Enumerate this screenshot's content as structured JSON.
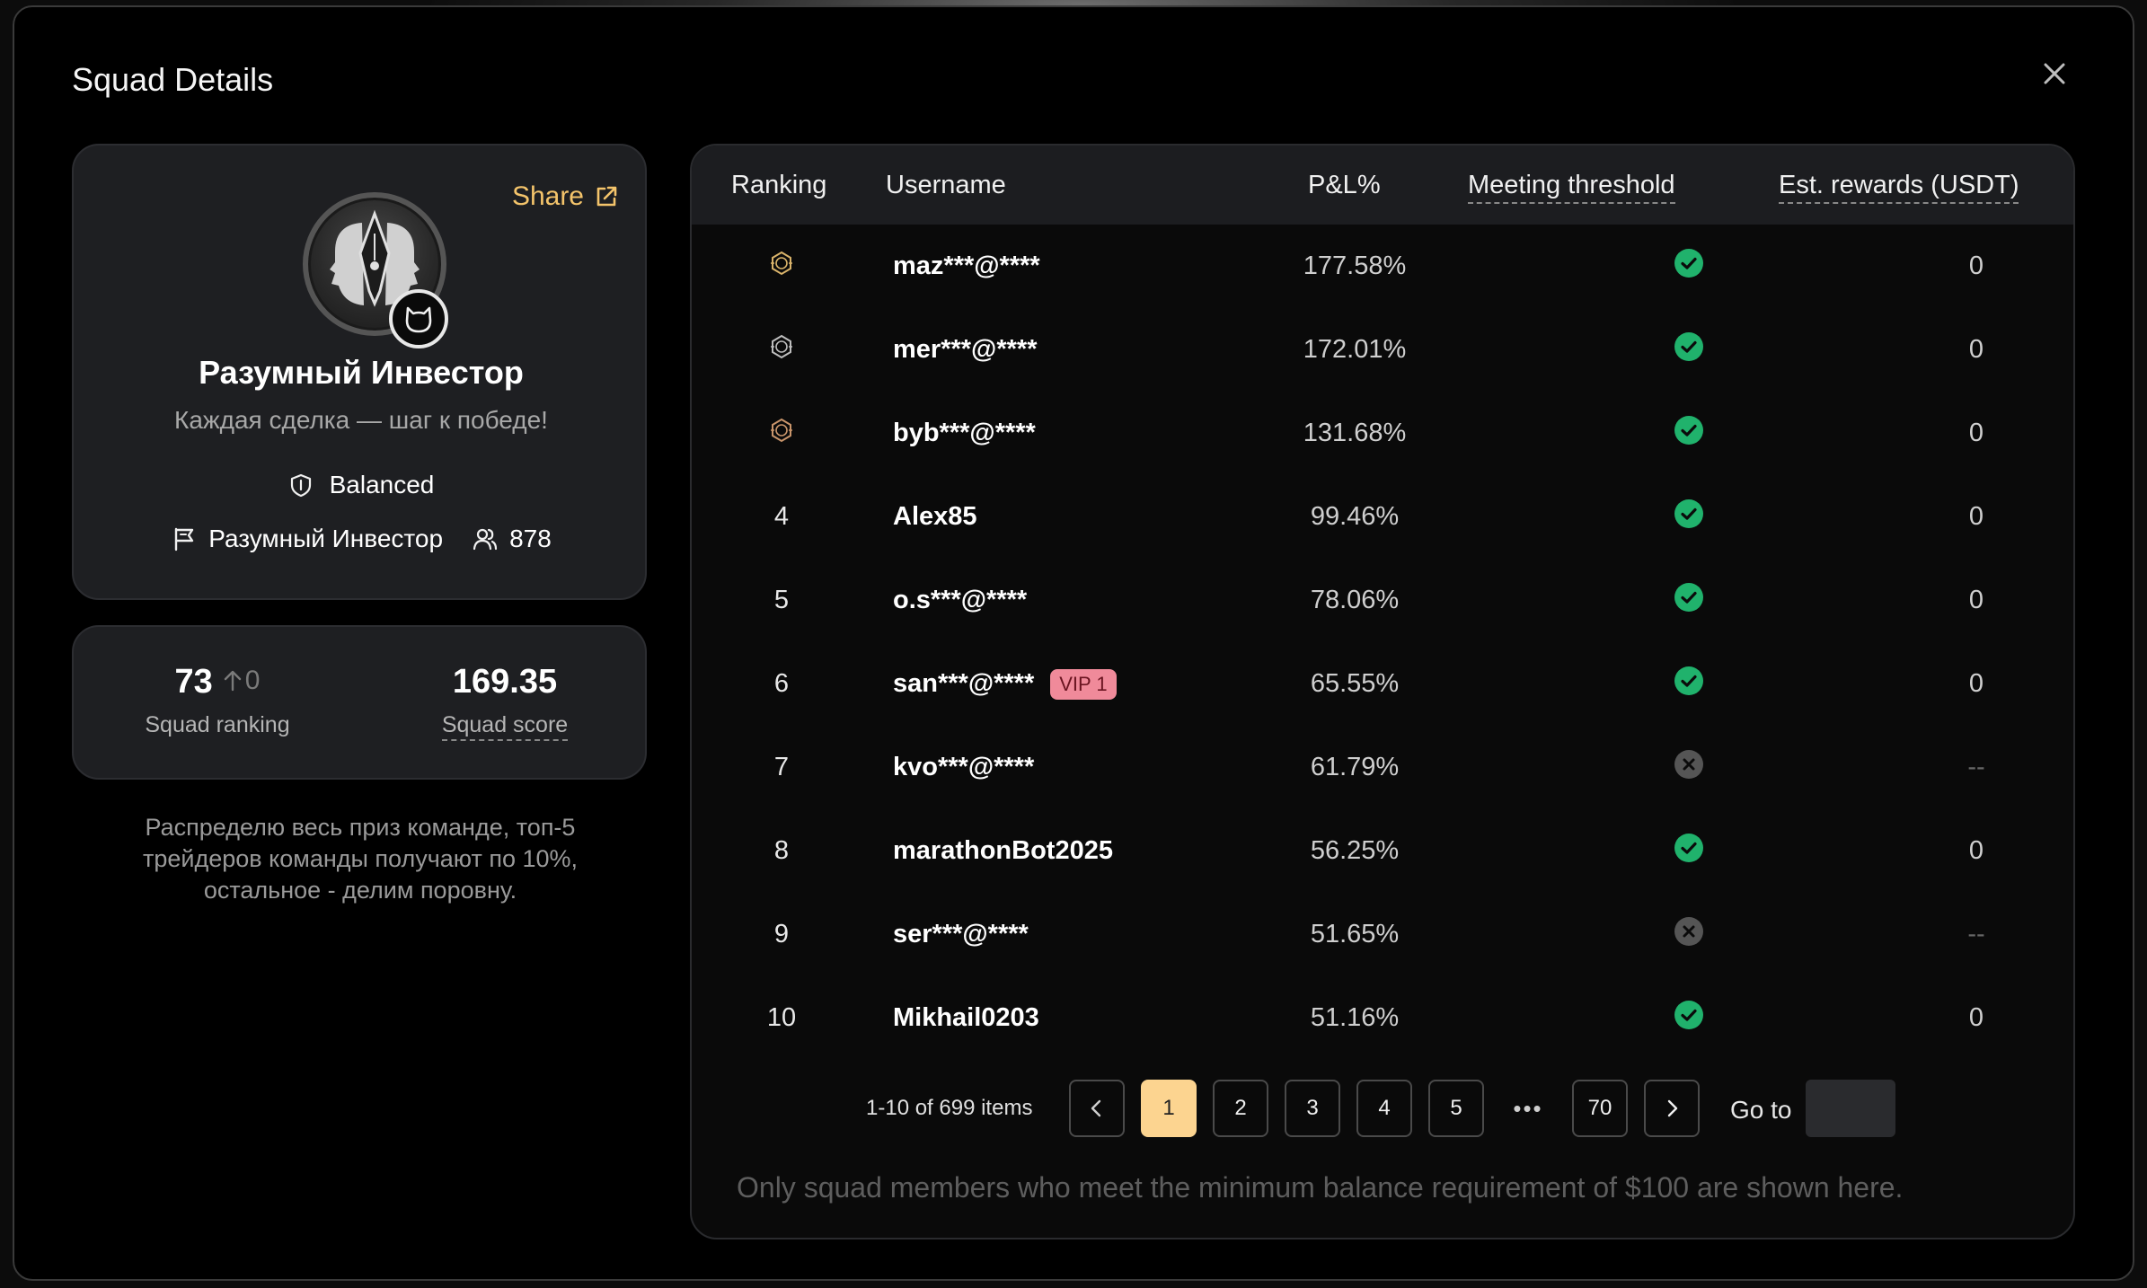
{
  "modal": {
    "title": "Squad Details"
  },
  "profile": {
    "share_label": "Share",
    "squad_name": "Разумный Инвестор",
    "motto": "Каждая сделка — шаг к победе!",
    "style": "Balanced",
    "leader_name": "Разумный Инвестор",
    "member_count": "878"
  },
  "stats": {
    "ranking": "73",
    "ranking_change": "0",
    "ranking_label": "Squad ranking",
    "score": "169.35",
    "score_label": "Squad score"
  },
  "description": "Распределю весь приз команде, топ-5 трейдеров команды получают по 10%, остальное - делим поровну.",
  "table": {
    "headers": {
      "ranking": "Ranking",
      "username": "Username",
      "pnl": "P&L%",
      "meeting": "Meeting threshold",
      "rewards": "Est. rewards (USDT)"
    },
    "rows": [
      {
        "rank": "1",
        "medal": "gold",
        "username": "maz***@****",
        "pnl": "177.58%",
        "meets": true,
        "reward": "0"
      },
      {
        "rank": "2",
        "medal": "silver",
        "username": "mer***@****",
        "pnl": "172.01%",
        "meets": true,
        "reward": "0"
      },
      {
        "rank": "3",
        "medal": "bronze",
        "username": "byb***@****",
        "pnl": "131.68%",
        "meets": true,
        "reward": "0"
      },
      {
        "rank": "4",
        "username": "Alex85",
        "pnl": "99.46%",
        "meets": true,
        "reward": "0"
      },
      {
        "rank": "5",
        "username": "o.s***@****",
        "pnl": "78.06%",
        "meets": true,
        "reward": "0"
      },
      {
        "rank": "6",
        "username": "san***@****",
        "vip": "VIP 1",
        "pnl": "65.55%",
        "meets": true,
        "reward": "0"
      },
      {
        "rank": "7",
        "username": "kvo***@****",
        "pnl": "61.79%",
        "meets": false,
        "reward": "--"
      },
      {
        "rank": "8",
        "username": "marathonBot2025",
        "pnl": "56.25%",
        "meets": true,
        "reward": "0"
      },
      {
        "rank": "9",
        "username": "ser***@****",
        "pnl": "51.65%",
        "meets": false,
        "reward": "--"
      },
      {
        "rank": "10",
        "username": "Mikhail0203",
        "pnl": "51.16%",
        "meets": true,
        "reward": "0"
      }
    ]
  },
  "pagination": {
    "info": "1-10 of 699 items",
    "pages": [
      "1",
      "2",
      "3",
      "4",
      "5"
    ],
    "ellipsis": "•••",
    "last_page": "70",
    "current": "1",
    "goto_label": "Go to",
    "goto_value": ""
  },
  "footnote": "Only squad members who meet the minimum balance requirement of $100 are shown here.",
  "colors": {
    "accent": "#f4c46b",
    "active_page": "#fcd490",
    "success": "#20b26c",
    "fail": "#555555",
    "vip": "#f08a9a"
  },
  "icons": {
    "close": "close-icon",
    "share": "external-link-icon",
    "style": "shield-icon",
    "leader": "flag-icon",
    "members": "users-icon",
    "change": "arrow-up-icon",
    "check": "check-circle-icon",
    "fail": "x-circle-icon",
    "prev": "chevron-left-icon",
    "next": "chevron-right-icon"
  }
}
